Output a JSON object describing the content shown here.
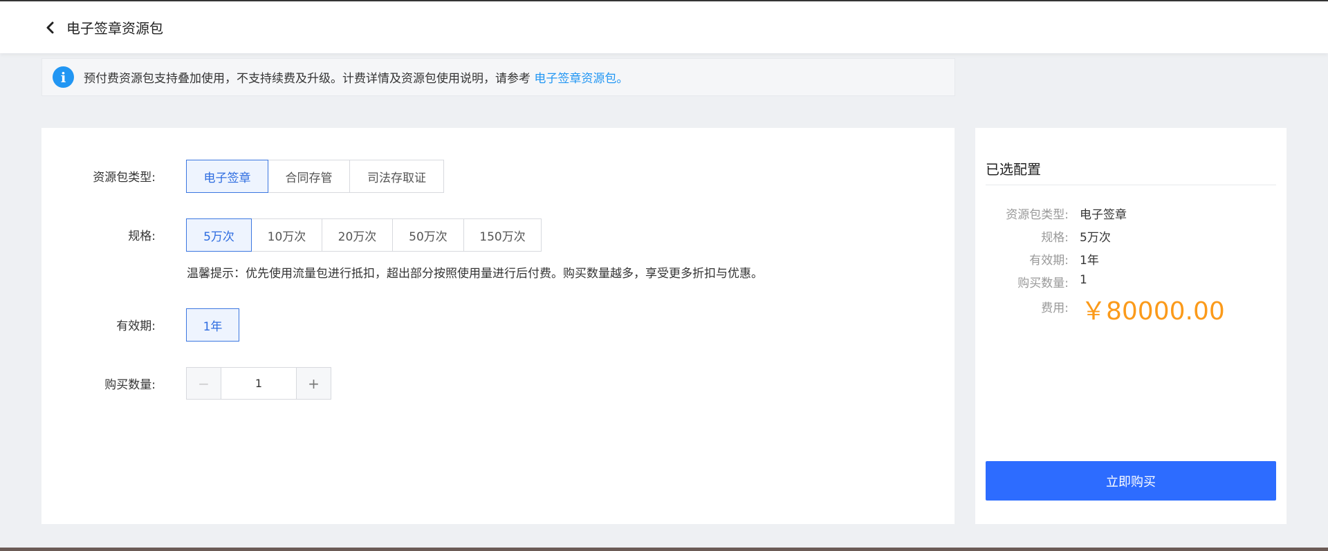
{
  "header": {
    "title": "电子签章资源包"
  },
  "notice": {
    "text": "预付费资源包支持叠加使用，不支持续费及升级。计费详情及资源包使用说明，请参考 ",
    "link": "电子签章资源包。"
  },
  "form": {
    "type_label": "资源包类型:",
    "types": [
      "电子签章",
      "合同存管",
      "司法存取证"
    ],
    "spec_label": "规格:",
    "specs": [
      "5万次",
      "10万次",
      "20万次",
      "50万次",
      "150万次"
    ],
    "tip": "温馨提示：优先使用流量包进行抵扣，超出部分按照使用量进行后付费。购买数量越多，享受更多折扣与优惠。",
    "validity_label": "有效期:",
    "validity": [
      "1年"
    ],
    "quantity_label": "购买数量:",
    "quantity_value": "1",
    "minus": "−",
    "plus": "+"
  },
  "summary": {
    "title": "已选配置",
    "rows": [
      {
        "label": "资源包类型:",
        "value": "电子签章"
      },
      {
        "label": "规格:",
        "value": "5万次"
      },
      {
        "label": "有效期:",
        "value": "1年"
      },
      {
        "label": "购买数量:",
        "value": "1"
      }
    ],
    "fee_label": "费用:",
    "price": "￥80000.00",
    "buy_button": "立即购买"
  }
}
